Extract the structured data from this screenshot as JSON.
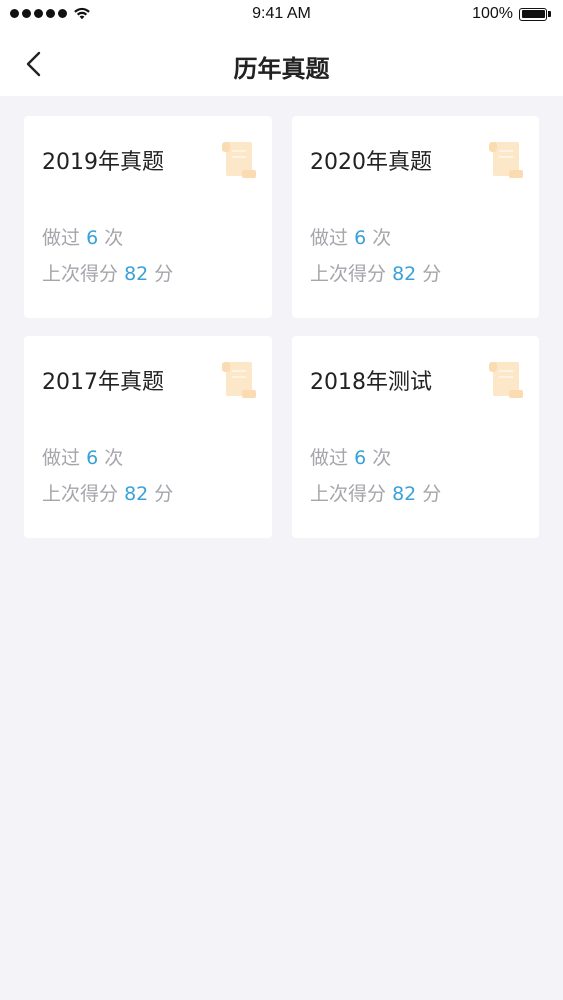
{
  "status_bar": {
    "time": "9:41 AM",
    "battery": "100%"
  },
  "header": {
    "title": "历年真题"
  },
  "cards": [
    {
      "title": "2019年真题",
      "done_prefix": "做过",
      "done_count": "6",
      "done_suffix": "次",
      "score_prefix": "上次得分",
      "score": "82",
      "score_suffix": "分"
    },
    {
      "title": "2020年真题",
      "done_prefix": "做过",
      "done_count": "6",
      "done_suffix": "次",
      "score_prefix": "上次得分",
      "score": "82",
      "score_suffix": "分"
    },
    {
      "title": "2017年真题",
      "done_prefix": "做过",
      "done_count": "6",
      "done_suffix": "次",
      "score_prefix": "上次得分",
      "score": "82",
      "score_suffix": "分"
    },
    {
      "title": "2018年测试",
      "done_prefix": "做过",
      "done_count": "6",
      "done_suffix": "次",
      "score_prefix": "上次得分",
      "score": "82",
      "score_suffix": "分"
    }
  ],
  "colors": {
    "accent": "#3aa1d8",
    "muted_text": "#a5a5ab",
    "background": "#f4f3f7",
    "icon_tint": "#fde7c9"
  },
  "icons": {
    "back": "chevron-left-icon",
    "card": "scroll-icon"
  }
}
